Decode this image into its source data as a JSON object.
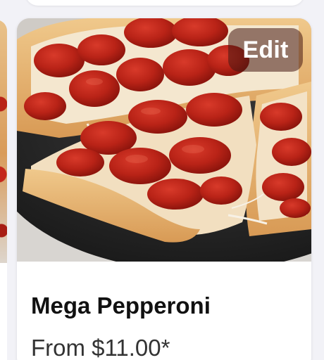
{
  "product": {
    "name": "Mega Pepperoni",
    "price_text": "From $11.00*",
    "edit_label": "Edit",
    "image_icon": "pizza-photo"
  },
  "colors": {
    "background": "#f2f2f7",
    "card": "#ffffff",
    "edit_overlay": "#46181299",
    "title_text": "#111111",
    "price_text": "#333333"
  }
}
